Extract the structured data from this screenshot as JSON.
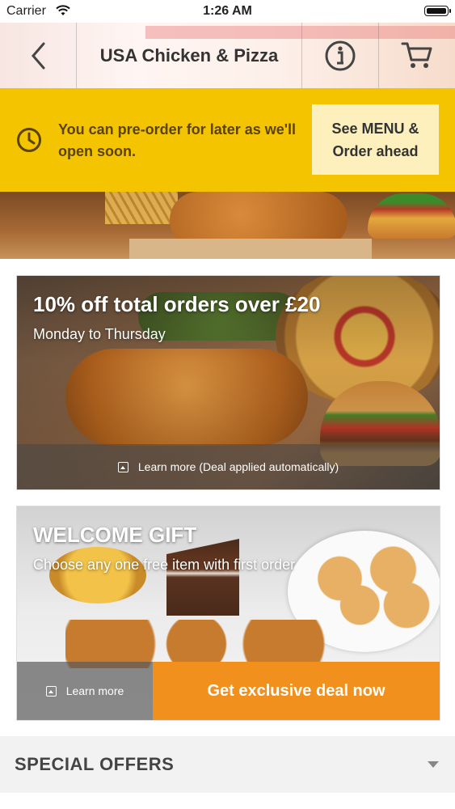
{
  "status_bar": {
    "carrier": "Carrier",
    "time": "1:26 AM",
    "icons": [
      "wifi-icon",
      "battery-icon"
    ]
  },
  "header": {
    "title": "USA Chicken & Pizza",
    "icons": [
      "back-chevron-icon",
      "info-icon",
      "cart-icon"
    ]
  },
  "preorder_banner": {
    "message": "You can pre-order for later as we'll open soon.",
    "cta_line1": "See MENU &",
    "cta_line2": "Order ahead",
    "icon": "clock-icon",
    "bg_color": "#f5c400"
  },
  "deals": [
    {
      "headline": "10% off total orders over £20",
      "subtitle": "Monday to Thursday",
      "learn_more": "Learn more (Deal applied automatically)"
    },
    {
      "headline": "WELCOME GIFT",
      "subtitle": "Choose any one free item with first order",
      "learn_more": "Learn more",
      "cta": "Get exclusive deal now",
      "cta_color": "#f1901c"
    }
  ],
  "special_offers": {
    "label": "SPECIAL OFFERS",
    "icon": "chevron-down-icon"
  }
}
